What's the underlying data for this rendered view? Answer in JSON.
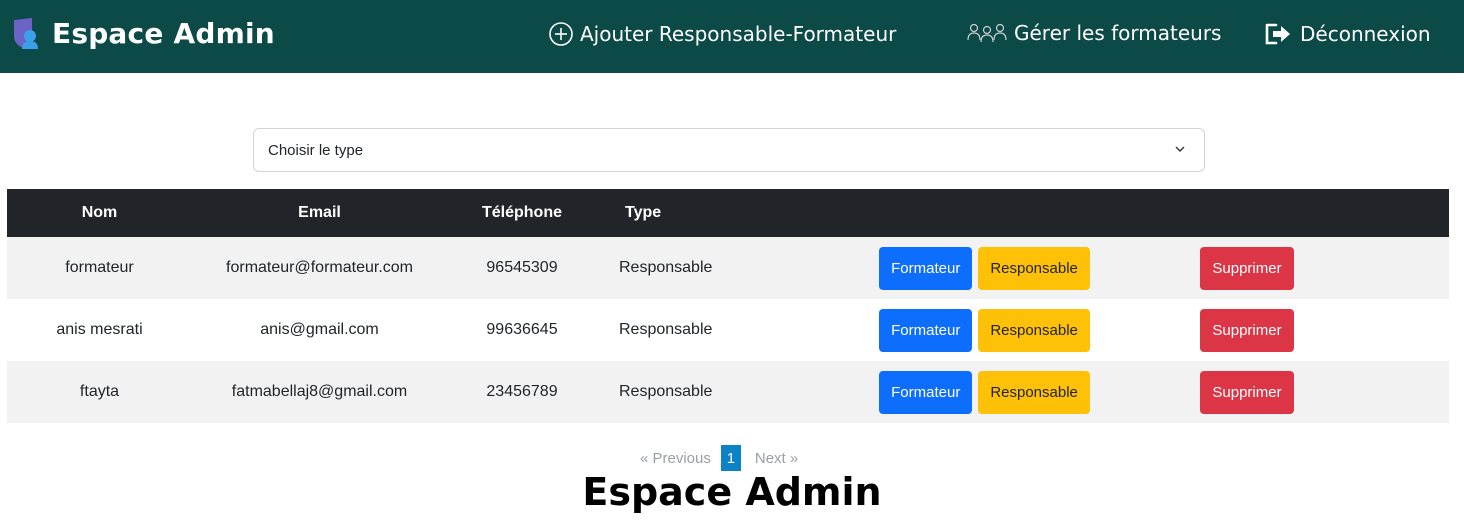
{
  "app": {
    "title": "Espace Admin"
  },
  "nav": {
    "add_label": "Ajouter Responsable-Formateur",
    "manage_label": "Gérer les formateurs",
    "logout_label": "Déconnexion"
  },
  "filter": {
    "selected": "Choisir le type"
  },
  "table": {
    "headers": [
      "Nom",
      "Email",
      "Téléphone",
      "Type"
    ],
    "rows": [
      {
        "nom": "formateur",
        "email": "formateur@formateur.com",
        "tel": "96545309",
        "type": "Responsable"
      },
      {
        "nom": "anis mesrati",
        "email": "anis@gmail.com",
        "tel": "99636645",
        "type": "Responsable"
      },
      {
        "nom": "ftayta",
        "email": "fatmabellaj8@gmail.com",
        "tel": "23456789",
        "type": "Responsable"
      }
    ],
    "actions": {
      "formateur": "Formateur",
      "responsable": "Responsable",
      "delete": "Supprimer"
    }
  },
  "pagination": {
    "prev": "« Previous",
    "current": "1",
    "next": "Next »"
  },
  "footer": {
    "title": "Espace Admin"
  },
  "colors": {
    "navbar": "#0b4a46",
    "primary": "#0d6efd",
    "warning": "#ffc107",
    "danger": "#dc3545",
    "table_head": "#212529",
    "page_active": "#0d83c7"
  },
  "icons": {
    "brand": "shield-user-icon",
    "add": "plus-circle-icon",
    "manage": "users-icon",
    "logout": "sign-out-icon",
    "select": "chevron-down-icon"
  }
}
